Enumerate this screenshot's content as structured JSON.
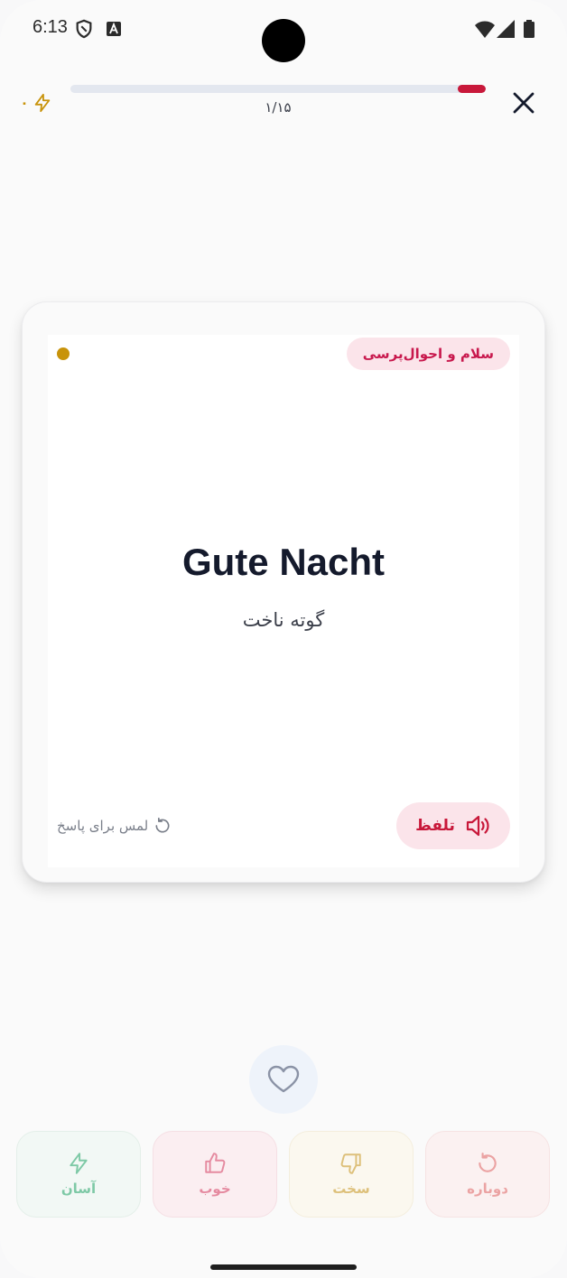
{
  "status_bar": {
    "time": "6:13"
  },
  "header": {
    "streak_count": "۰",
    "progress_label": "۱/۱۵",
    "progress_fraction": 0.0667
  },
  "card": {
    "category": "سلام و احوال‌پرسی",
    "word": "Gute Nacht",
    "pronunciation": "گوته ناخت",
    "speak_label": "تلفظ",
    "tap_hint": "لمس برای پاسخ"
  },
  "ratings": {
    "easy": "آسان",
    "good": "خوب",
    "hard": "سخت",
    "again": "دوباره"
  },
  "colors": {
    "accent": "#c8183a",
    "streak": "#c8930a",
    "easy": "#7ec9a6",
    "good": "#e58aa0",
    "hard": "#ddc07a",
    "again": "#eba3a3"
  }
}
